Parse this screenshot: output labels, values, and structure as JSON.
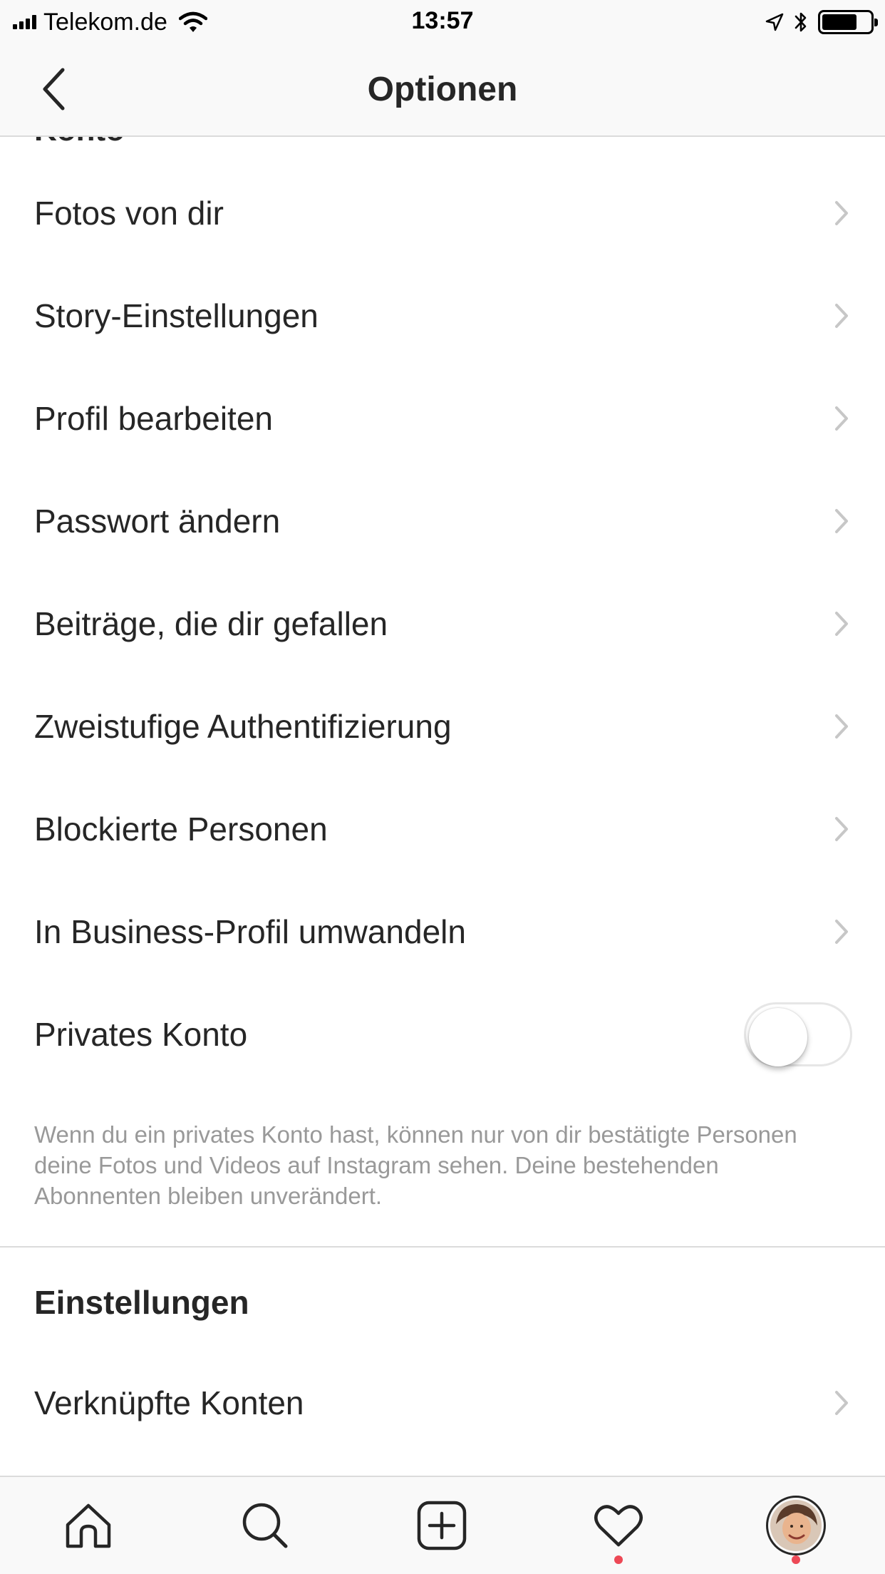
{
  "status_bar": {
    "carrier": "Telekom.de",
    "time": "13:57",
    "icons": [
      "signal-icon",
      "wifi-icon",
      "location-arrow-icon",
      "bluetooth-icon",
      "battery-icon"
    ]
  },
  "nav": {
    "title": "Optionen",
    "back_icon": "chevron-left-icon"
  },
  "sections": {
    "partial_heading": "Konto",
    "account_items": [
      {
        "label": "Fotos von dir"
      },
      {
        "label": "Story-Einstellungen"
      },
      {
        "label": "Profil bearbeiten"
      },
      {
        "label": "Passwort ändern"
      },
      {
        "label": "Beiträge, die dir gefallen"
      },
      {
        "label": "Zweistufige Authentifizierung"
      },
      {
        "label": "Blockierte Personen"
      },
      {
        "label": "In Business-Profil umwandeln"
      }
    ],
    "private_account": {
      "label": "Privates Konto",
      "enabled": false,
      "help": "Wenn du ein privates Konto hast, können nur von dir bestätigte Personen deine Fotos und Videos auf Instagram sehen. Deine bestehenden Abonnenten bleiben unverändert."
    },
    "settings_heading": "Einstellungen",
    "settings_items": [
      {
        "label": "Verknüpfte Konten"
      }
    ]
  },
  "tab_bar": {
    "tabs": [
      {
        "icon": "home-icon"
      },
      {
        "icon": "search-icon"
      },
      {
        "icon": "add-post-icon"
      },
      {
        "icon": "heart-icon",
        "badge": true
      },
      {
        "icon": "profile-avatar",
        "badge": true
      }
    ]
  },
  "colors": {
    "text": "#262626",
    "secondary_text": "#999999",
    "chevron": "#c7c7c7",
    "bar_background": "#f9f9f9",
    "divider": "#dbdbdb",
    "badge": "#ed4956"
  }
}
